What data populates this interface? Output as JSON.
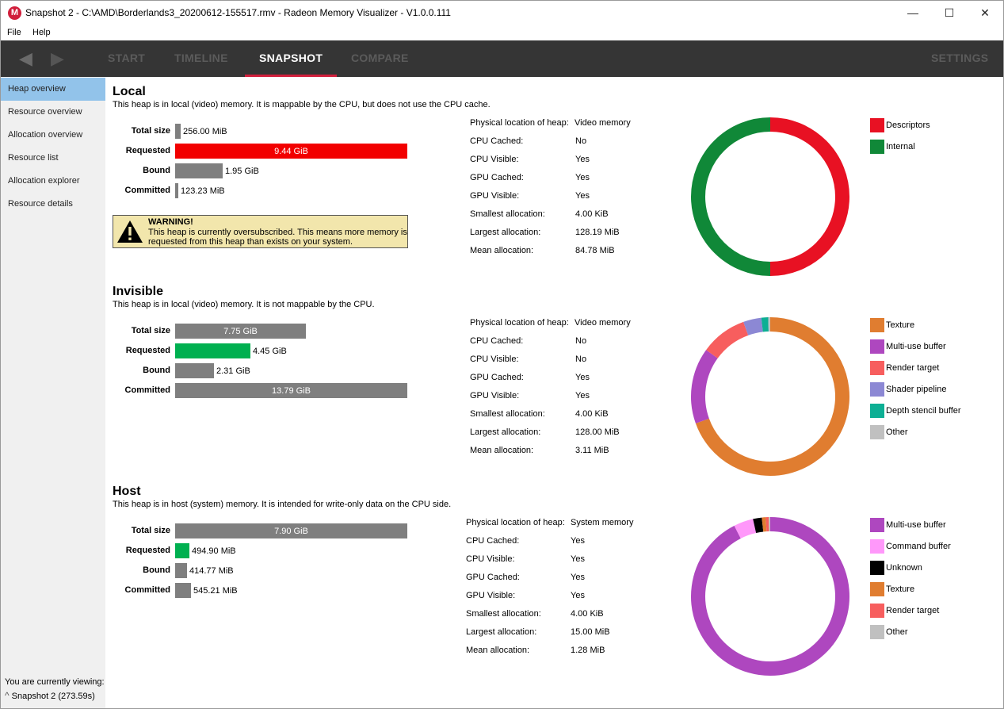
{
  "window": {
    "icon_letter": "M",
    "title": "Snapshot 2 - C:\\AMD\\Borderlands3_20200612-155517.rmv - Radeon Memory Visualizer - V1.0.0.111",
    "minimize": "—",
    "maximize": "☐",
    "close": "✕"
  },
  "menu": {
    "file": "File",
    "help": "Help"
  },
  "nav": {
    "back": "◀",
    "forward": "▶",
    "tabs": [
      "START",
      "TIMELINE",
      "SNAPSHOT",
      "COMPARE"
    ],
    "settings": "SETTINGS",
    "active_tab": "SNAPSHOT"
  },
  "sidebar": {
    "items": [
      "Heap overview",
      "Resource overview",
      "Allocation overview",
      "Resource list",
      "Allocation explorer",
      "Resource details"
    ],
    "active": "Heap overview",
    "viewing_label": "You are currently viewing:",
    "viewing_value": "Snapshot 2 (273.59s)"
  },
  "bar_labels": {
    "total": "Total size",
    "requested": "Requested",
    "bound": "Bound",
    "committed": "Committed"
  },
  "prop_labels": {
    "physical": "Physical location of heap:",
    "cpu_cached": "CPU Cached:",
    "cpu_visible": "CPU Visible:",
    "gpu_cached": "GPU Cached:",
    "gpu_visible": "GPU Visible:",
    "smallest": "Smallest allocation:",
    "largest": "Largest allocation:",
    "mean": "Mean allocation:"
  },
  "colors": {
    "descriptors": "#e81123",
    "internal": "#108838",
    "texture": "#e07d30",
    "multi_use_buffer": "#ae47bf",
    "render_target": "#f75e5e",
    "shader_pipeline": "#8c88d4",
    "depth_stencil_buffer": "#0daf94",
    "other": "#c0c0c0",
    "command_buffer": "#ff98fa",
    "unknown": "#000000"
  },
  "heaps": {
    "local": {
      "title": "Local",
      "description": "This heap is in local (video) memory. It is mappable by the CPU, but does not use the CPU cache.",
      "bars": {
        "total": {
          "text": "256.00 MiB",
          "fraction": 0.024
        },
        "requested": {
          "text": "9.44 GiB",
          "fraction": 1.0
        },
        "bound": {
          "text": "1.95 GiB",
          "fraction": 0.205
        },
        "committed": {
          "text": "123.23 MiB",
          "fraction": 0.012
        }
      },
      "warning": {
        "title": "WARNING!",
        "line1": "This heap is currently oversubscribed. This means more memory is",
        "line2": "requested from this heap than exists on your system."
      },
      "props": {
        "physical": "Video memory",
        "cpu_cached": "No",
        "cpu_visible": "Yes",
        "gpu_cached": "Yes",
        "gpu_visible": "Yes",
        "smallest": "4.00 KiB",
        "largest": "128.19 MiB",
        "mean": "84.78 MiB"
      },
      "legend": [
        {
          "label": "Descriptors",
          "color": "#e81123"
        },
        {
          "label": "Internal",
          "color": "#108838"
        }
      ],
      "donut": [
        {
          "name": "Descriptors",
          "fraction": 0.5,
          "color": "#e81123"
        },
        {
          "name": "Internal",
          "fraction": 0.5,
          "color": "#108838"
        }
      ]
    },
    "invisible": {
      "title": "Invisible",
      "description": "This heap is in local (video) memory. It is not mappable by the CPU.",
      "bars": {
        "total": {
          "text": "7.75 GiB",
          "fraction": 0.562
        },
        "requested": {
          "text": "4.45 GiB",
          "fraction": 0.323
        },
        "bound": {
          "text": "2.31 GiB",
          "fraction": 0.168
        },
        "committed": {
          "text": "13.79 GiB",
          "fraction": 1.0
        }
      },
      "props": {
        "physical": "Video memory",
        "cpu_cached": "No",
        "cpu_visible": "No",
        "gpu_cached": "Yes",
        "gpu_visible": "Yes",
        "smallest": "4.00 KiB",
        "largest": "128.00 MiB",
        "mean": "3.11 MiB"
      },
      "legend": [
        {
          "label": "Texture",
          "color": "#e07d30"
        },
        {
          "label": "Multi-use buffer",
          "color": "#ae47bf"
        },
        {
          "label": "Render target",
          "color": "#f75e5e"
        },
        {
          "label": "Shader pipeline",
          "color": "#8c88d4"
        },
        {
          "label": "Depth stencil buffer",
          "color": "#0daf94"
        },
        {
          "label": "Other",
          "color": "#c0c0c0"
        }
      ],
      "donut": [
        {
          "name": "Texture",
          "fraction": 0.695,
          "color": "#e07d30"
        },
        {
          "name": "Multi-use buffer",
          "fraction": 0.155,
          "color": "#ae47bf"
        },
        {
          "name": "Render target",
          "fraction": 0.095,
          "color": "#f75e5e"
        },
        {
          "name": "Shader pipeline",
          "fraction": 0.037,
          "color": "#8c88d4"
        },
        {
          "name": "Depth stencil buffer",
          "fraction": 0.014,
          "color": "#0daf94"
        },
        {
          "name": "Other",
          "fraction": 0.004,
          "color": "#c0c0c0"
        }
      ]
    },
    "host": {
      "title": "Host",
      "description": "This heap is in host (system) memory. It is intended for write-only data on the CPU side.",
      "bars": {
        "total": {
          "text": "7.90 GiB",
          "fraction": 1.0
        },
        "requested": {
          "text": "494.90 MiB",
          "fraction": 0.061
        },
        "bound": {
          "text": "414.77 MiB",
          "fraction": 0.051
        },
        "committed": {
          "text": "545.21 MiB",
          "fraction": 0.067
        }
      },
      "props": {
        "physical": "System memory",
        "cpu_cached": "Yes",
        "cpu_visible": "Yes",
        "gpu_cached": "Yes",
        "gpu_visible": "Yes",
        "smallest": "4.00 KiB",
        "largest": "15.00 MiB",
        "mean": "1.28 MiB"
      },
      "legend": [
        {
          "label": "Multi-use buffer",
          "color": "#ae47bf"
        },
        {
          "label": "Command buffer",
          "color": "#ff98fa"
        },
        {
          "label": "Unknown",
          "color": "#000000"
        },
        {
          "label": "Texture",
          "color": "#e07d30"
        },
        {
          "label": "Render target",
          "color": "#f75e5e"
        },
        {
          "label": "Other",
          "color": "#c0c0c0"
        }
      ],
      "donut": [
        {
          "name": "Multi-use buffer",
          "fraction": 0.925,
          "color": "#ae47bf"
        },
        {
          "name": "Command buffer",
          "fraction": 0.04,
          "color": "#ff98fa"
        },
        {
          "name": "Unknown",
          "fraction": 0.018,
          "color": "#000000"
        },
        {
          "name": "Texture",
          "fraction": 0.008,
          "color": "#e07d30"
        },
        {
          "name": "Render target",
          "fraction": 0.006,
          "color": "#f75e5e"
        },
        {
          "name": "Other",
          "fraction": 0.003,
          "color": "#c0c0c0"
        }
      ]
    }
  }
}
